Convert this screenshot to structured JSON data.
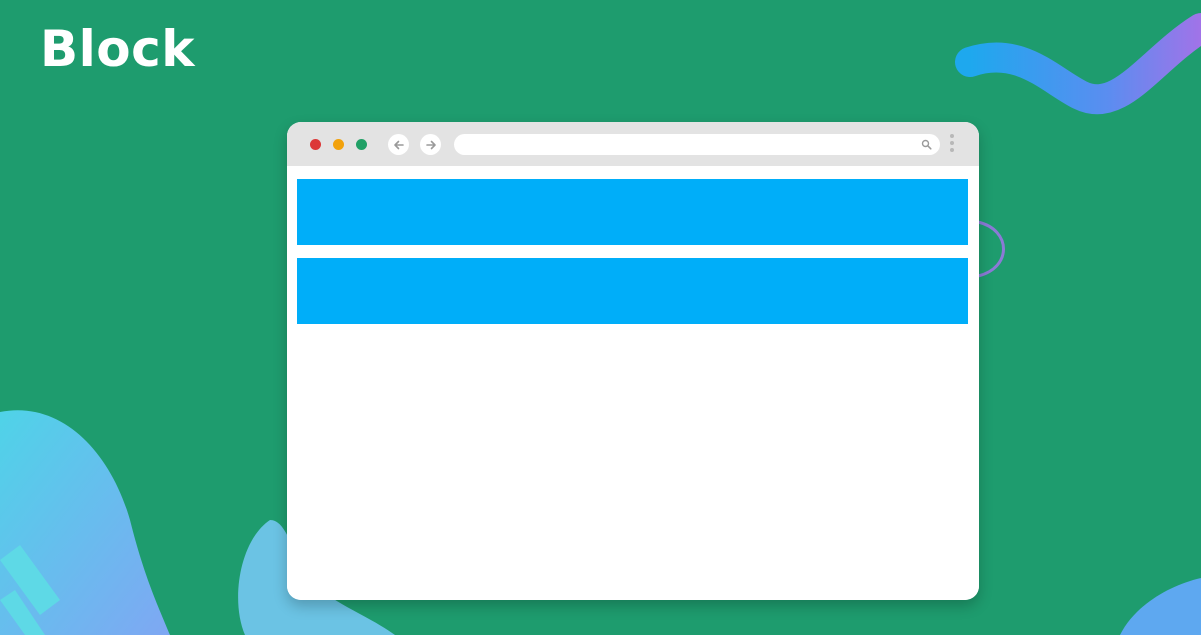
{
  "slide": {
    "title": "Block"
  },
  "colors": {
    "background": "#1e9c6e",
    "block": "#00aef9",
    "window": "#ffffff",
    "titlebar": "#e3e3e3"
  },
  "browser": {
    "traffic_lights": [
      "red",
      "yellow",
      "green"
    ],
    "icons": [
      "back-arrow-icon",
      "forward-arrow-icon",
      "search-icon",
      "more-vertical-icon"
    ],
    "block_count": 2
  }
}
